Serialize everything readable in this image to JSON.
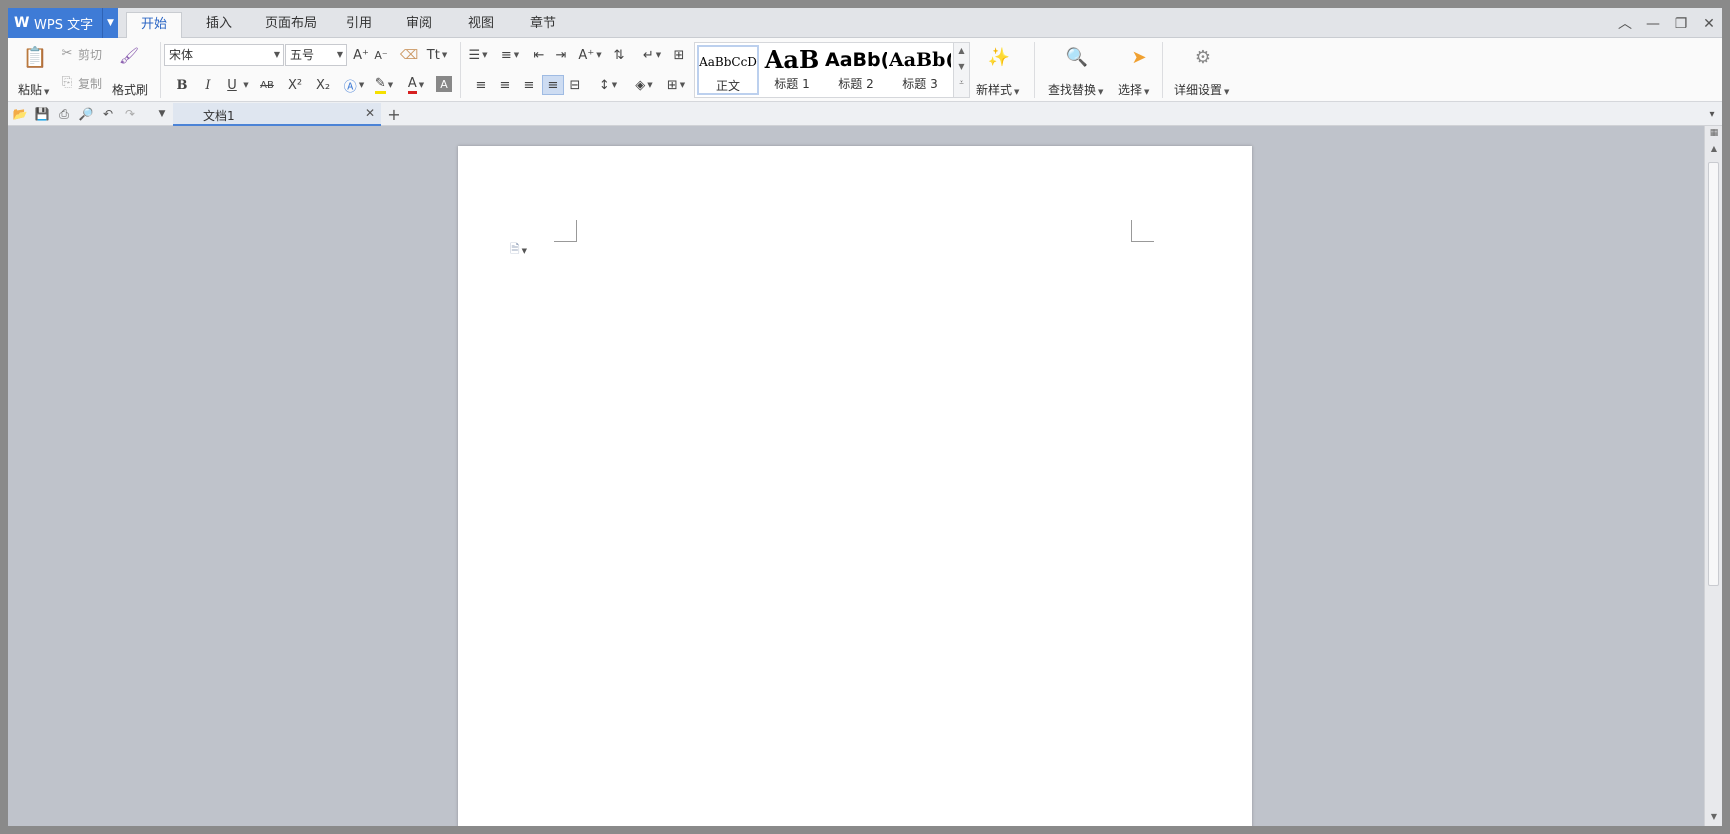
{
  "app": {
    "title": "WPS 文字"
  },
  "menu_tabs": [
    {
      "label": "开始",
      "active": true
    },
    {
      "label": "插入"
    },
    {
      "label": "页面布局"
    },
    {
      "label": "引用"
    },
    {
      "label": "审阅"
    },
    {
      "label": "视图"
    },
    {
      "label": "章节"
    }
  ],
  "clipboard": {
    "paste": "粘贴",
    "cut": "剪切",
    "copy": "复制",
    "format_painter": "格式刷"
  },
  "font": {
    "name": "宋体",
    "size": "五号"
  },
  "font_buttons": {
    "bold": "B",
    "italic": "I",
    "underline": "U",
    "strike": "AB",
    "superscript": "X²",
    "subscript": "X₂",
    "grow": "A⁺",
    "shrink": "A⁻",
    "font_color": "A",
    "char_shade": "A"
  },
  "styles": [
    {
      "preview": "AaBbCcD",
      "name": "正文"
    },
    {
      "preview": "AaB",
      "name": "标题 1"
    },
    {
      "preview": "AaBb(",
      "name": "标题 2"
    },
    {
      "preview": "AaBb(",
      "name": "标题 3"
    }
  ],
  "new_style": "新样式",
  "find_replace": "查找替换",
  "select": "选择",
  "detail_settings": "详细设置",
  "document_tab": {
    "title": "文档1"
  },
  "colors": {
    "accent": "#3e7bd6",
    "workspace": "#bfc3cb"
  }
}
